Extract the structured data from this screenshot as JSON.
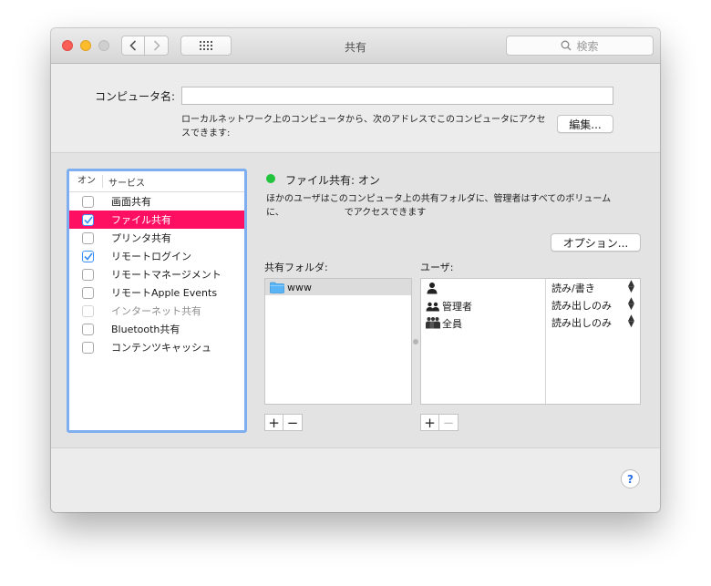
{
  "window": {
    "title": "共有"
  },
  "toolbar": {
    "search_placeholder": "検索"
  },
  "computer_name": {
    "label": "コンピュータ名:",
    "value": "",
    "description": "ローカルネットワーク上のコンピュータから、次のアドレスでこのコンピュータにアクセスできます:",
    "edit_button": "編集..."
  },
  "services": {
    "header_on": "オン",
    "header_service": "サービス",
    "items": [
      {
        "name": "画面共有",
        "checked": false,
        "selected": false,
        "disabled": false
      },
      {
        "name": "ファイル共有",
        "checked": true,
        "selected": true,
        "disabled": false
      },
      {
        "name": "プリンタ共有",
        "checked": false,
        "selected": false,
        "disabled": false
      },
      {
        "name": "リモートログイン",
        "checked": true,
        "selected": false,
        "disabled": false
      },
      {
        "name": "リモートマネージメント",
        "checked": false,
        "selected": false,
        "disabled": false
      },
      {
        "name": "リモートApple Events",
        "checked": false,
        "selected": false,
        "disabled": false
      },
      {
        "name": "インターネット共有",
        "checked": false,
        "selected": false,
        "disabled": true
      },
      {
        "name": "Bluetooth共有",
        "checked": false,
        "selected": false,
        "disabled": false
      },
      {
        "name": "コンテンツキャッシュ",
        "checked": false,
        "selected": false,
        "disabled": false
      }
    ]
  },
  "detail": {
    "status": "ファイル共有: オン",
    "status_color": "#22c43d",
    "description_line1": "ほかのユーザはこのコンピュータ上の共有フォルダに、管理者はすべてのボリューム",
    "description_line2_prefix": "に、",
    "description_line2_suffix": "でアクセスできます",
    "options_button": "オプション...",
    "shared_folders_label": "共有フォルダ:",
    "users_label": "ユーザ:",
    "folders": [
      {
        "name": "www"
      }
    ],
    "users": [
      {
        "icon": "single-user-icon",
        "name": "",
        "permission": "読み/書き"
      },
      {
        "icon": "group-icon",
        "name": "管理者",
        "permission": "読み出しのみ"
      },
      {
        "icon": "everyone-icon",
        "name": "全員",
        "permission": "読み出しのみ"
      }
    ],
    "add": "+",
    "remove": "−"
  },
  "help": {
    "label": "?"
  },
  "colors": {
    "selection": "#fe0f62",
    "focus_ring": "#7eaef0",
    "checkbox_check": "#3b8ff6"
  }
}
